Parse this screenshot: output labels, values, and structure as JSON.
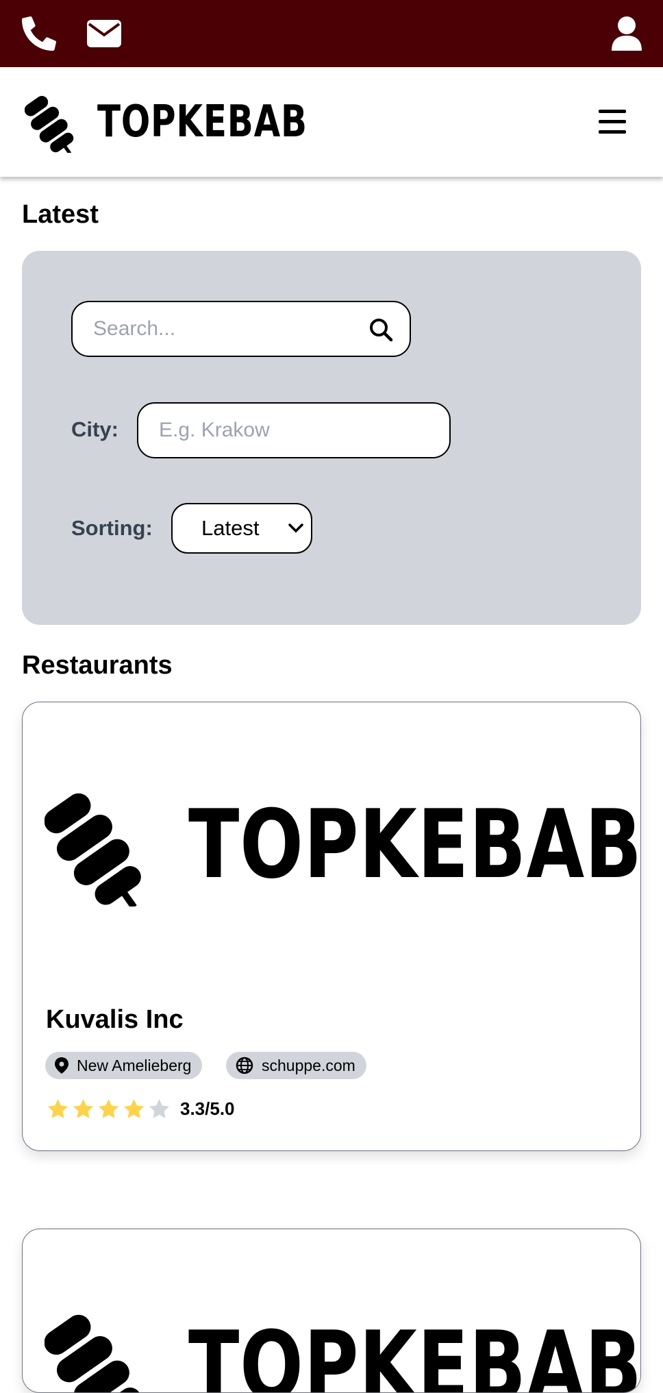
{
  "topbar": {
    "bg_color": "#4a0005",
    "icons": [
      "phone-icon",
      "envelope-icon",
      "user-icon"
    ]
  },
  "header": {
    "brand": "TOPKEBAB",
    "menu_icon": "hamburger-icon"
  },
  "latest": {
    "heading": "Latest"
  },
  "filters": {
    "search": {
      "placeholder": "Search...",
      "value": ""
    },
    "city": {
      "label": "City:",
      "placeholder": "E.g. Krakow",
      "value": ""
    },
    "sorting": {
      "label": "Sorting:",
      "selected": "Latest"
    }
  },
  "restaurants": {
    "heading": "Restaurants",
    "items": [
      {
        "logo_text": "TOPKEBAB",
        "name": "Kuvalis Inc",
        "location": "New Amelieberg",
        "website": "schuppe.com",
        "rating_text": "3.3/5.0",
        "rating_value": 3.3,
        "stars_filled": 4
      },
      {
        "logo_text": "TOPKEBAB"
      }
    ]
  },
  "colors": {
    "star_filled": "#fcd34d",
    "star_empty": "#d1d5db",
    "panel_bg": "#d1d5db"
  }
}
